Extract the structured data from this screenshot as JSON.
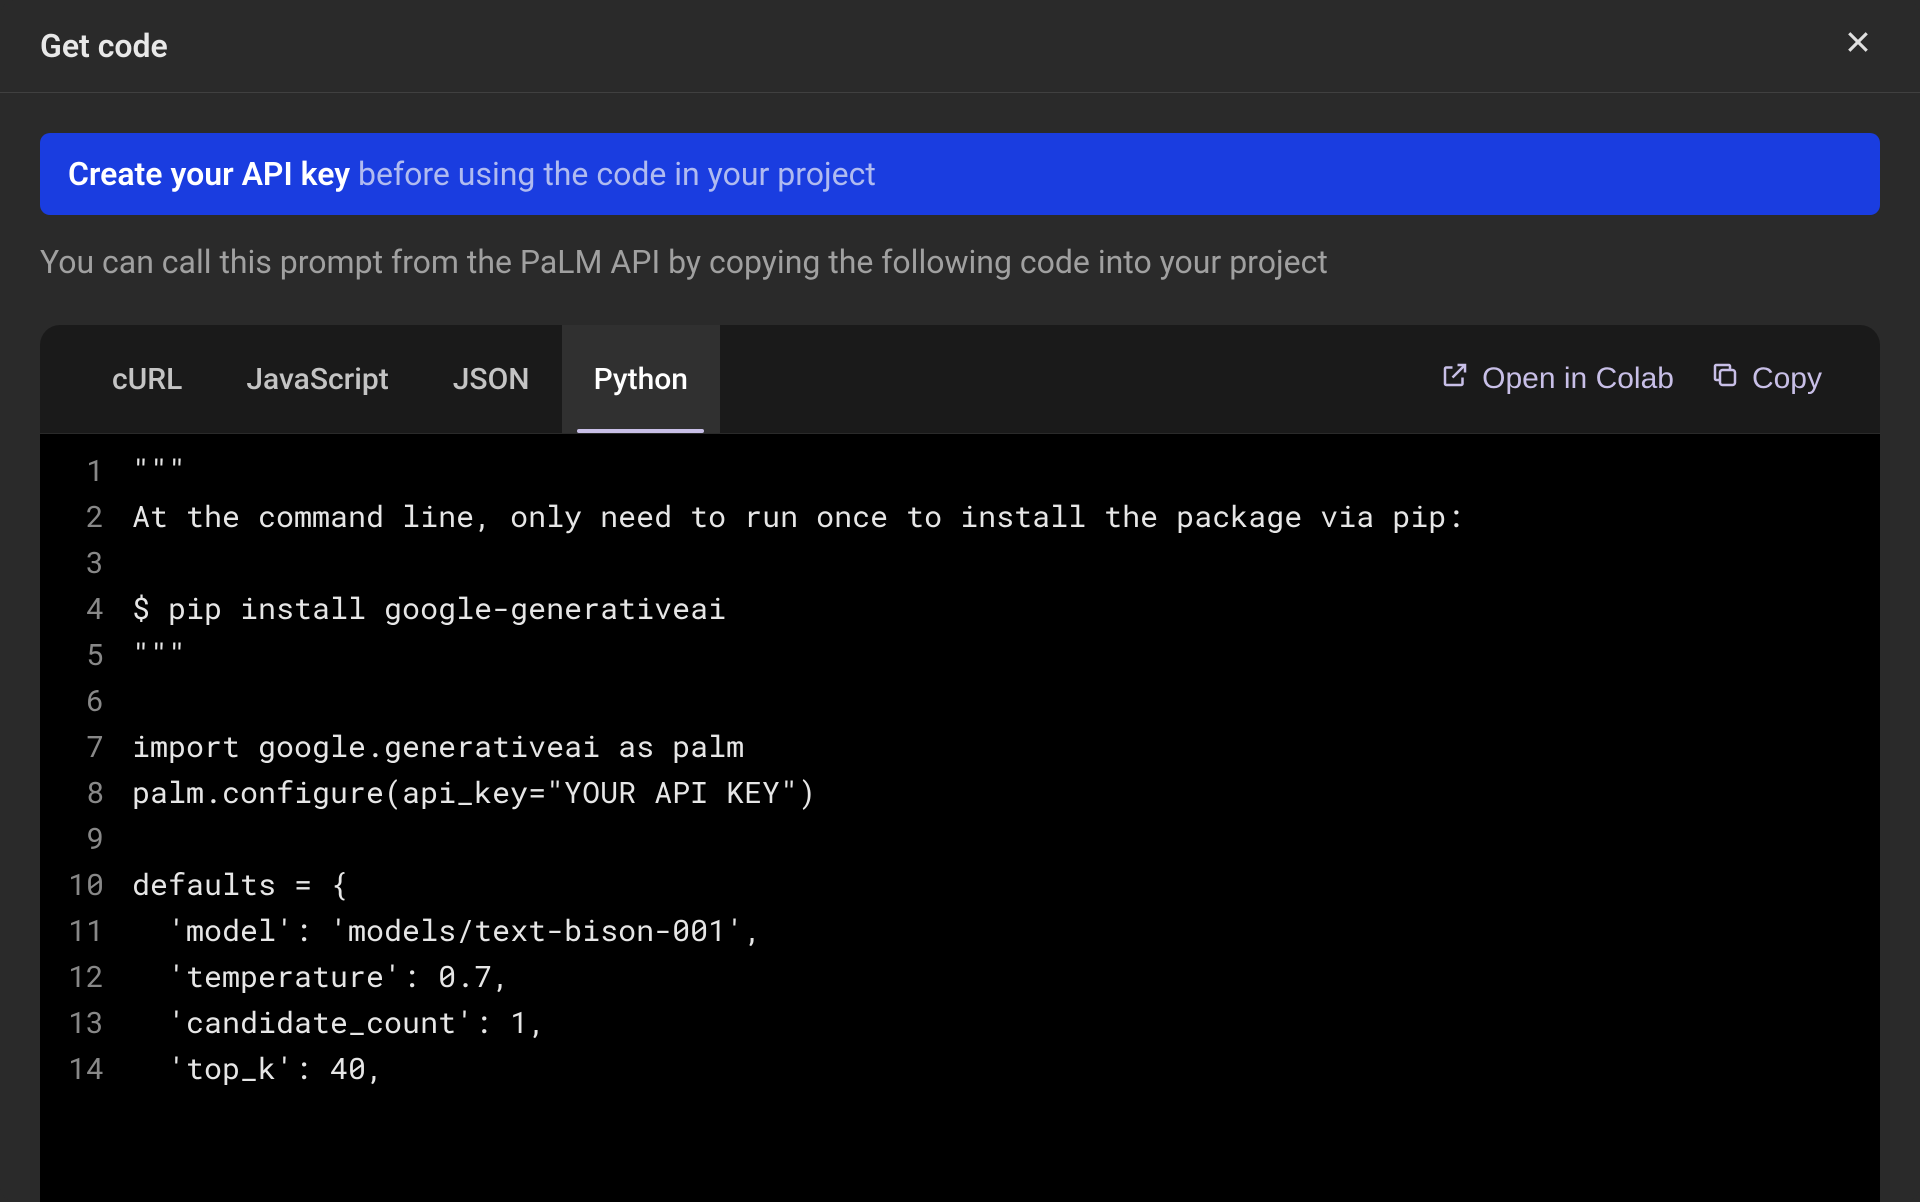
{
  "header": {
    "title": "Get code"
  },
  "banner": {
    "link_text": "Create your API key",
    "rest_text": " before using the code in your project"
  },
  "description": "You can call this prompt from the PaLM API by copying the following code into your project",
  "tabs": {
    "curl": "cURL",
    "javascript": "JavaScript",
    "json": "JSON",
    "python": "Python"
  },
  "actions": {
    "open_colab": "Open in Colab",
    "copy": "Copy"
  },
  "code": {
    "lines": [
      "\"\"\"",
      "At the command line, only need to run once to install the package via pip:",
      "",
      "$ pip install google-generativeai",
      "\"\"\"",
      "",
      "import google.generativeai as palm",
      "palm.configure(api_key=\"YOUR API KEY\")",
      "",
      "defaults = {",
      "  'model': 'models/text-bison-001',",
      "  'temperature': 0.7,",
      "  'candidate_count': 1,",
      "  'top_k': 40,"
    ]
  }
}
